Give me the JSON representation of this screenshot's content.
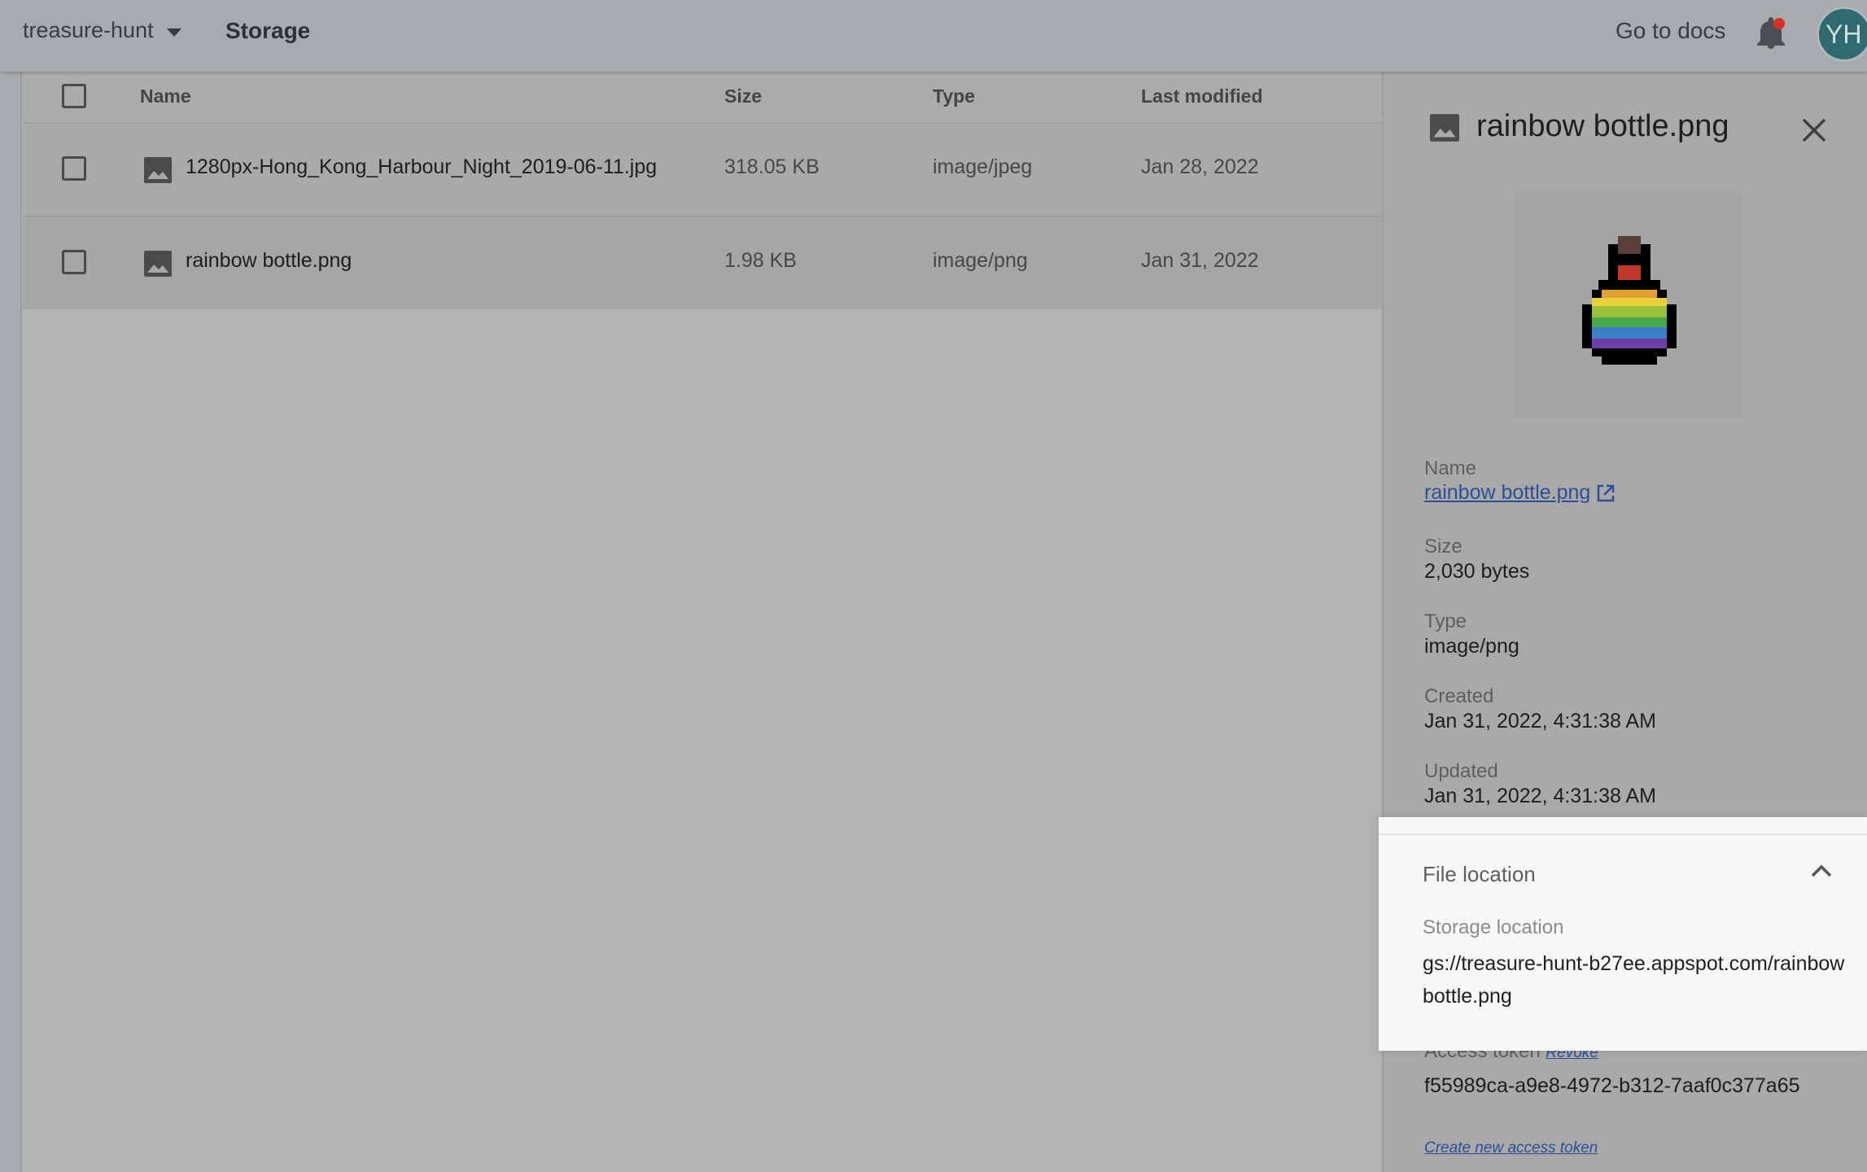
{
  "header": {
    "project": "treasure-hunt",
    "section": "Storage",
    "docs_link": "Go to docs",
    "avatar_initials": "YH"
  },
  "table": {
    "columns": [
      "Name",
      "Size",
      "Type",
      "Last modified"
    ],
    "rows": [
      {
        "name": "1280px-Hong_Kong_Harbour_Night_2019-06-11.jpg",
        "size": "318.05 KB",
        "type": "image/jpeg",
        "modified": "Jan 28, 2022"
      },
      {
        "name": "rainbow bottle.png",
        "size": "1.98 KB",
        "type": "image/png",
        "modified": "Jan 31, 2022"
      }
    ]
  },
  "panel": {
    "title": "rainbow bottle.png",
    "name_label": "Name",
    "name_value": "rainbow bottle.png",
    "size_label": "Size",
    "size_value": "2,030 bytes",
    "type_label": "Type",
    "type_value": "image/png",
    "created_label": "Created",
    "created_value": "Jan 31, 2022, 4:31:38 AM",
    "updated_label": "Updated",
    "updated_value": "Jan 31, 2022, 4:31:38 AM",
    "file_location_title": "File location",
    "storage_location_label": "Storage location",
    "storage_location_value": "gs://treasure-hunt-b27ee.appspot.com/rainbow bottle.png",
    "access_token_label": "Access token",
    "revoke_label": "Revoke",
    "access_token_value": "f55989ca-a9e8-4972-b312-7aaf0c377a65",
    "create_token_label": "Create new access token"
  },
  "colors": {
    "avatar_bg": "#2f6a70",
    "link": "#2c4f95",
    "bell_badge": "#d93025",
    "overlay": "#b3b3b3"
  }
}
